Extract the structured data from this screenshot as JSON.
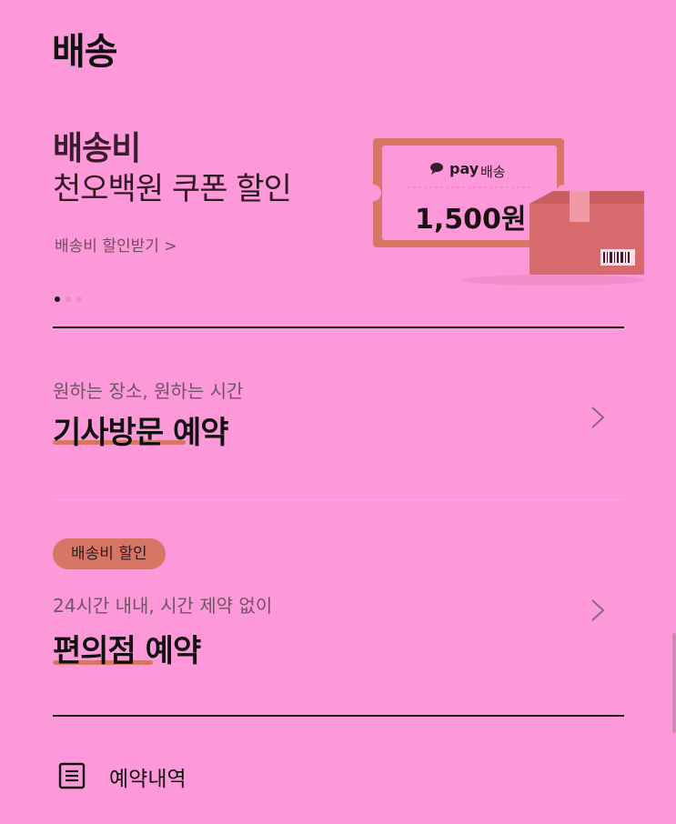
{
  "header": {
    "title": "배송"
  },
  "banner": {
    "title": "배송비",
    "subtitle": "천오백원 쿠폰 할인",
    "link": "배송비 할인받기 >",
    "coupon": {
      "brand": "pay",
      "label": "배송",
      "amount": "1,500원"
    }
  },
  "carousel": {
    "total": 3,
    "active": 0
  },
  "options": [
    {
      "subtitle": "원하는 장소, 원하는 시간",
      "title": "기사방문 예약"
    },
    {
      "badge": "배송비 할인",
      "subtitle": "24시간 내내, 시간 제약 없이",
      "title": "편의점 예약"
    }
  ],
  "history": {
    "label": "예약내역"
  },
  "colors": {
    "background": "#fd98d9",
    "accent": "#d77665"
  }
}
